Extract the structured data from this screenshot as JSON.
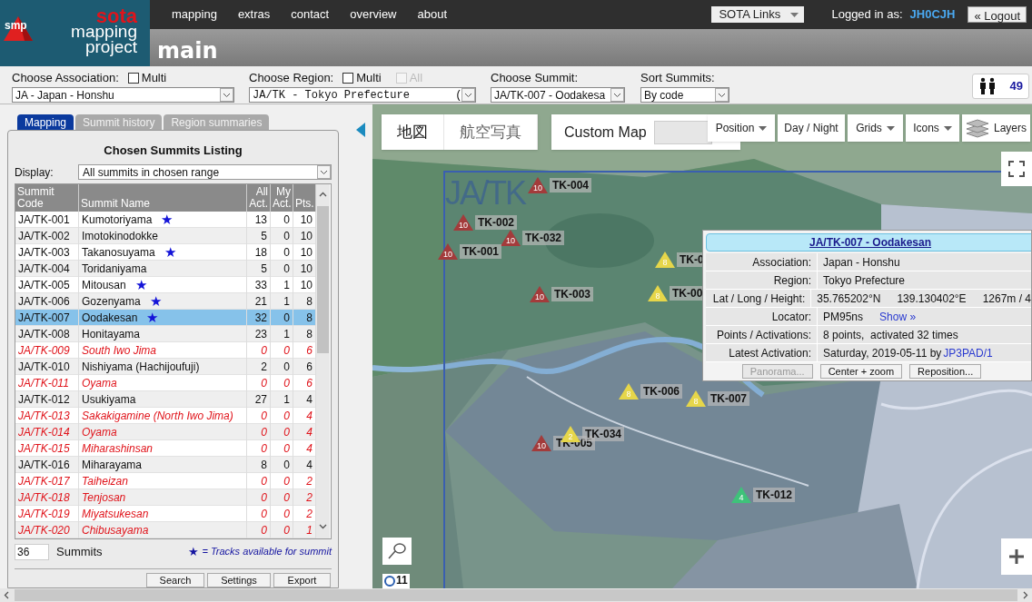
{
  "header": {
    "logo": {
      "badge": "smp",
      "line_1": "sota",
      "line_2": "mapping",
      "line_3": "project"
    },
    "nav": [
      "mapping",
      "extras",
      "contact",
      "overview",
      "about"
    ],
    "links_button": "SOTA Links",
    "login_label": "Logged in as:",
    "user": "JH0CJH",
    "logout": "« Logout",
    "page_title": "main"
  },
  "selectors": [
    {
      "label": "Choose Association:",
      "options": [
        {
          "label": "Multi",
          "checked": false,
          "disabled": false
        }
      ],
      "value": "JA - Japan - Honshu"
    },
    {
      "label": "Choose Region:",
      "options": [
        {
          "label": "Multi",
          "checked": false,
          "disabled": false
        },
        {
          "label": "All",
          "checked": false,
          "disabled": true
        }
      ],
      "value": "JA/TK - Tokyo Prefecture       ("
    },
    {
      "label": "Choose Summit:",
      "value": "JA/TK-007 - Oodakesa"
    },
    {
      "label": "Sort Summits:",
      "value": "By code"
    }
  ],
  "online": {
    "count": "49"
  },
  "tabs": [
    {
      "label": "Mapping",
      "selected": true
    },
    {
      "label": "Summit history",
      "selected": false
    },
    {
      "label": "Region summaries",
      "selected": false
    }
  ],
  "listing": {
    "title": "Chosen Summits Listing",
    "display_label": "Display:",
    "display_value": "All summits in chosen range",
    "columns": [
      [
        "Summit",
        "Code"
      ],
      [
        "Summit Name"
      ],
      [
        "All",
        "Act."
      ],
      [
        "My",
        "Act."
      ],
      [
        "Pts."
      ]
    ],
    "rows": [
      {
        "code": "JA/TK-001",
        "name": "Kumotoriyama",
        "all": "13",
        "my": "0",
        "pts": "10",
        "tracks": true,
        "activated": true,
        "selected": false
      },
      {
        "code": "JA/TK-002",
        "name": "Imotokinodokke",
        "all": "5",
        "my": "0",
        "pts": "10",
        "tracks": false,
        "activated": true,
        "selected": false
      },
      {
        "code": "JA/TK-003",
        "name": "Takanosuyama",
        "all": "18",
        "my": "0",
        "pts": "10",
        "tracks": true,
        "activated": true,
        "selected": false
      },
      {
        "code": "JA/TK-004",
        "name": "Toridaniyama",
        "all": "5",
        "my": "0",
        "pts": "10",
        "tracks": false,
        "activated": true,
        "selected": false
      },
      {
        "code": "JA/TK-005",
        "name": "Mitousan",
        "all": "33",
        "my": "1",
        "pts": "10",
        "tracks": true,
        "activated": true,
        "selected": false
      },
      {
        "code": "JA/TK-006",
        "name": "Gozenyama",
        "all": "21",
        "my": "1",
        "pts": "8",
        "tracks": true,
        "activated": true,
        "selected": false
      },
      {
        "code": "JA/TK-007",
        "name": "Oodakesan",
        "all": "32",
        "my": "0",
        "pts": "8",
        "tracks": true,
        "activated": true,
        "selected": true
      },
      {
        "code": "JA/TK-008",
        "name": "Honitayama",
        "all": "23",
        "my": "1",
        "pts": "8",
        "tracks": false,
        "activated": true,
        "selected": false
      },
      {
        "code": "JA/TK-009",
        "name": "South Iwo Jima",
        "all": "0",
        "my": "0",
        "pts": "6",
        "tracks": false,
        "activated": false,
        "selected": false
      },
      {
        "code": "JA/TK-010",
        "name": "Nishiyama (Hachijoufuji)",
        "all": "2",
        "my": "0",
        "pts": "6",
        "tracks": false,
        "activated": true,
        "selected": false
      },
      {
        "code": "JA/TK-011",
        "name": "Oyama",
        "all": "0",
        "my": "0",
        "pts": "6",
        "tracks": false,
        "activated": false,
        "selected": false
      },
      {
        "code": "JA/TK-012",
        "name": "Usukiyama",
        "all": "27",
        "my": "1",
        "pts": "4",
        "tracks": false,
        "activated": true,
        "selected": false
      },
      {
        "code": "JA/TK-013",
        "name": "Sakakigamine (North Iwo Jima)",
        "all": "0",
        "my": "0",
        "pts": "4",
        "tracks": false,
        "activated": false,
        "selected": false
      },
      {
        "code": "JA/TK-014",
        "name": "Oyama",
        "all": "0",
        "my": "0",
        "pts": "4",
        "tracks": false,
        "activated": false,
        "selected": false
      },
      {
        "code": "JA/TK-015",
        "name": "Miharashinsan",
        "all": "0",
        "my": "0",
        "pts": "4",
        "tracks": false,
        "activated": false,
        "selected": false
      },
      {
        "code": "JA/TK-016",
        "name": "Miharayama",
        "all": "8",
        "my": "0",
        "pts": "4",
        "tracks": false,
        "activated": true,
        "selected": false
      },
      {
        "code": "JA/TK-017",
        "name": "Taiheizan",
        "all": "0",
        "my": "0",
        "pts": "2",
        "tracks": false,
        "activated": false,
        "selected": false
      },
      {
        "code": "JA/TK-018",
        "name": "Tenjosan",
        "all": "0",
        "my": "0",
        "pts": "2",
        "tracks": false,
        "activated": false,
        "selected": false
      },
      {
        "code": "JA/TK-019",
        "name": "Miyatsukesan",
        "all": "0",
        "my": "0",
        "pts": "2",
        "tracks": false,
        "activated": false,
        "selected": false
      },
      {
        "code": "JA/TK-020",
        "name": "Chibusayama",
        "all": "0",
        "my": "0",
        "pts": "1",
        "tracks": false,
        "activated": false,
        "selected": false
      }
    ],
    "count": "36",
    "count_label": "Summits",
    "legend_mark": "★",
    "legend": "= Tracks available for summit",
    "buttons": [
      "Search",
      "Settings",
      "Export"
    ]
  },
  "map": {
    "map_types": [
      {
        "label": "地図",
        "selected": true
      },
      {
        "label": "航空写真",
        "selected": false
      }
    ],
    "custom_map": "Custom Map",
    "controls": [
      {
        "label": "Position",
        "kind": "dropdown"
      },
      {
        "label": "Day / Night",
        "kind": "button"
      },
      {
        "label": "Grids",
        "kind": "dropdown"
      },
      {
        "label": "Icons",
        "kind": "dropdown"
      },
      {
        "label": "Layers",
        "kind": "layers"
      }
    ],
    "region_label": "JA/TK",
    "markers": [
      {
        "label": "TK-004",
        "points": "10",
        "color": "#a33b3b"
      },
      {
        "label": "TK-002",
        "points": "10",
        "color": "#a33b3b"
      },
      {
        "label": "TK-032",
        "points": "10",
        "color": "#a33b3b"
      },
      {
        "label": "TK-001",
        "points": "10",
        "color": "#a33b3b"
      },
      {
        "label": "TK-0",
        "points": "8",
        "color": "#e6d64a"
      },
      {
        "label": "TK-003",
        "points": "10",
        "color": "#a33b3b"
      },
      {
        "label": "TK-00",
        "points": "8",
        "color": "#e6d64a"
      },
      {
        "label": "TK-006",
        "points": "8",
        "color": "#e6d64a"
      },
      {
        "label": "TK-007",
        "points": "8",
        "color": "#e6d64a"
      },
      {
        "label": "TK-005",
        "points": "10",
        "color": "#a33b3b"
      },
      {
        "label": "TK-034",
        "points": "2",
        "color": "#e6d64a"
      },
      {
        "label": "TK-012",
        "points": "4",
        "color": "#3fc27a"
      }
    ],
    "badge": "11",
    "popup": {
      "title": "JA/TK-007 - Oodakesan",
      "fields": [
        {
          "label": "Association:",
          "values": [
            {
              "text": "Japan - Honshu",
              "link": false
            }
          ]
        },
        {
          "label": "Region:",
          "values": [
            {
              "text": "Tokyo Prefecture",
              "link": false
            }
          ]
        },
        {
          "label": "Lat / Long / Height:",
          "values": [
            {
              "text": "35.765202°N",
              "link": false
            },
            {
              "text": "139.130402°E",
              "link": false
            },
            {
              "text": "1267m / 4",
              "link": false
            }
          ]
        },
        {
          "label": "Locator:",
          "values": [
            {
              "text": "PM95ns",
              "link": false
            },
            {
              "text": "Show »",
              "link": true
            }
          ]
        },
        {
          "label": "Points / Activations:",
          "values": [
            {
              "text": "8 points,  activated 32 times",
              "link": false
            }
          ]
        },
        {
          "label": "Latest Activation:",
          "values": [
            {
              "text": "Saturday, 2019-05-11 by",
              "link": false
            },
            {
              "text": "JP3PAD/1",
              "link": true
            }
          ]
        }
      ],
      "buttons": [
        {
          "label": "Panorama...",
          "disabled": true
        },
        {
          "label": "Center + zoom",
          "disabled": false
        },
        {
          "label": "Reposition...",
          "disabled": false
        }
      ]
    }
  }
}
